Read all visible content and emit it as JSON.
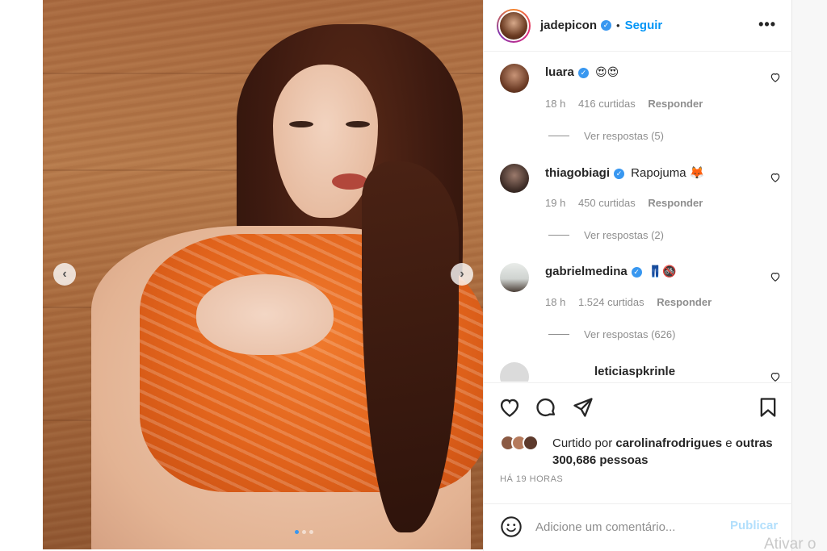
{
  "post": {
    "username": "jadepicon",
    "separator": "•",
    "follow_label": "Seguir",
    "more_label": "•••",
    "prev_arrow": "‹",
    "next_arrow": "›"
  },
  "comments": [
    {
      "username": "luara",
      "verified": true,
      "text": "😍😍",
      "time": "18 h",
      "likes": "416 curtidas",
      "reply_label": "Responder",
      "view_replies": "Ver respostas (5)"
    },
    {
      "username": "thiagobiagi",
      "verified": true,
      "text": "Rapojuma 🦊",
      "time": "19 h",
      "likes": "450 curtidas",
      "reply_label": "Responder",
      "view_replies": "Ver respostas (2)"
    },
    {
      "username": "gabrielmedina",
      "verified": true,
      "text": "👖🚳",
      "time": "18 h",
      "likes": "1.524 curtidas",
      "reply_label": "Responder",
      "view_replies": "Ver respostas (626)"
    },
    {
      "username": "leticiaspkrinle",
      "verified": false,
      "text": ""
    }
  ],
  "likes_summary": {
    "prefix": "Curtido por",
    "user": "carolinafrodrigues",
    "suffix": "e",
    "others": "outras 300,686 pessoas"
  },
  "timestamp": "HÁ 19 HORAS",
  "add_comment": {
    "placeholder": "Adicione um comentário...",
    "publish_label": "Publicar"
  },
  "watermark": "Ativar o",
  "colors": {
    "accent": "#0095f6",
    "verified": "#3897f0",
    "muted": "#8e8e8e",
    "publish_disabled": "#b2dffc"
  }
}
